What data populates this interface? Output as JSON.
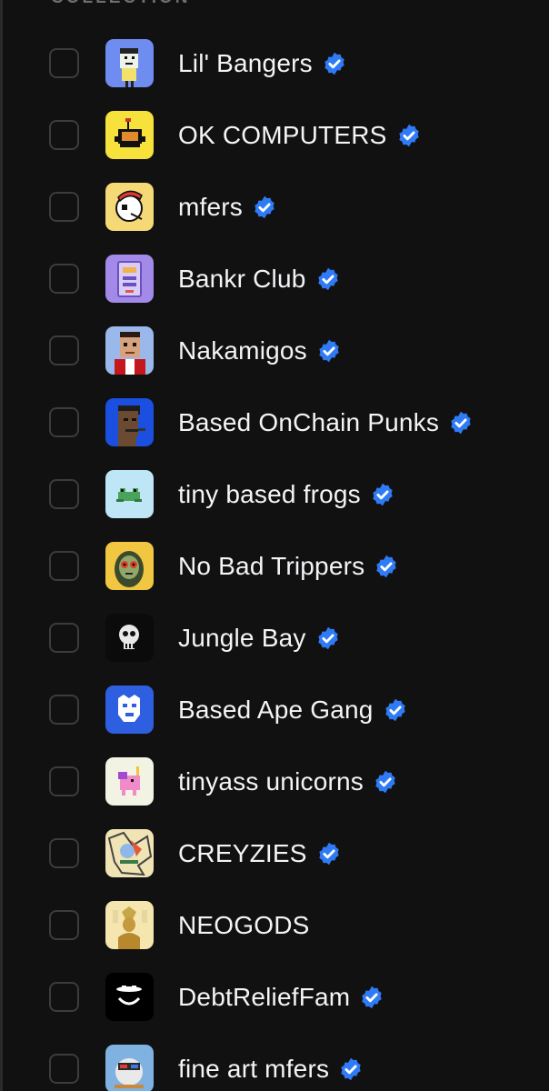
{
  "section": {
    "label": "COLLECTION"
  },
  "collections": [
    {
      "name": "Lil' Bangers",
      "verified": true,
      "checked": false,
      "icon": "lil-bangers-avatar"
    },
    {
      "name": "OK COMPUTERS",
      "verified": true,
      "checked": false,
      "icon": "ok-computers-avatar"
    },
    {
      "name": "mfers",
      "verified": true,
      "checked": false,
      "icon": "mfers-avatar"
    },
    {
      "name": "Bankr Club",
      "verified": true,
      "checked": false,
      "icon": "bankr-club-avatar"
    },
    {
      "name": "Nakamigos",
      "verified": true,
      "checked": false,
      "icon": "nakamigos-avatar"
    },
    {
      "name": "Based OnChain Punks",
      "verified": true,
      "checked": false,
      "icon": "based-onchain-punks-avatar"
    },
    {
      "name": "tiny based frogs",
      "verified": true,
      "checked": false,
      "icon": "tiny-based-frogs-avatar"
    },
    {
      "name": "No Bad Trippers",
      "verified": true,
      "checked": false,
      "icon": "no-bad-trippers-avatar"
    },
    {
      "name": "Jungle Bay",
      "verified": true,
      "checked": false,
      "icon": "jungle-bay-avatar"
    },
    {
      "name": "Based Ape Gang",
      "verified": true,
      "checked": false,
      "icon": "based-ape-gang-avatar"
    },
    {
      "name": "tinyass unicorns",
      "verified": true,
      "checked": false,
      "icon": "tinyass-unicorns-avatar"
    },
    {
      "name": "CREYZIES",
      "verified": true,
      "checked": false,
      "icon": "creyzies-avatar"
    },
    {
      "name": "NEOGODS",
      "verified": false,
      "checked": false,
      "icon": "neogods-avatar"
    },
    {
      "name": "DebtReliefFam",
      "verified": true,
      "checked": false,
      "icon": "debt-relief-fam-avatar"
    },
    {
      "name": "fine art mfers",
      "verified": true,
      "checked": false,
      "icon": "fine-art-mfers-avatar"
    }
  ],
  "colors": {
    "background": "#111112",
    "text": "#f4f4f6",
    "checkbox_border": "#3c3c40",
    "verified_badge": "#2f7bf6"
  }
}
